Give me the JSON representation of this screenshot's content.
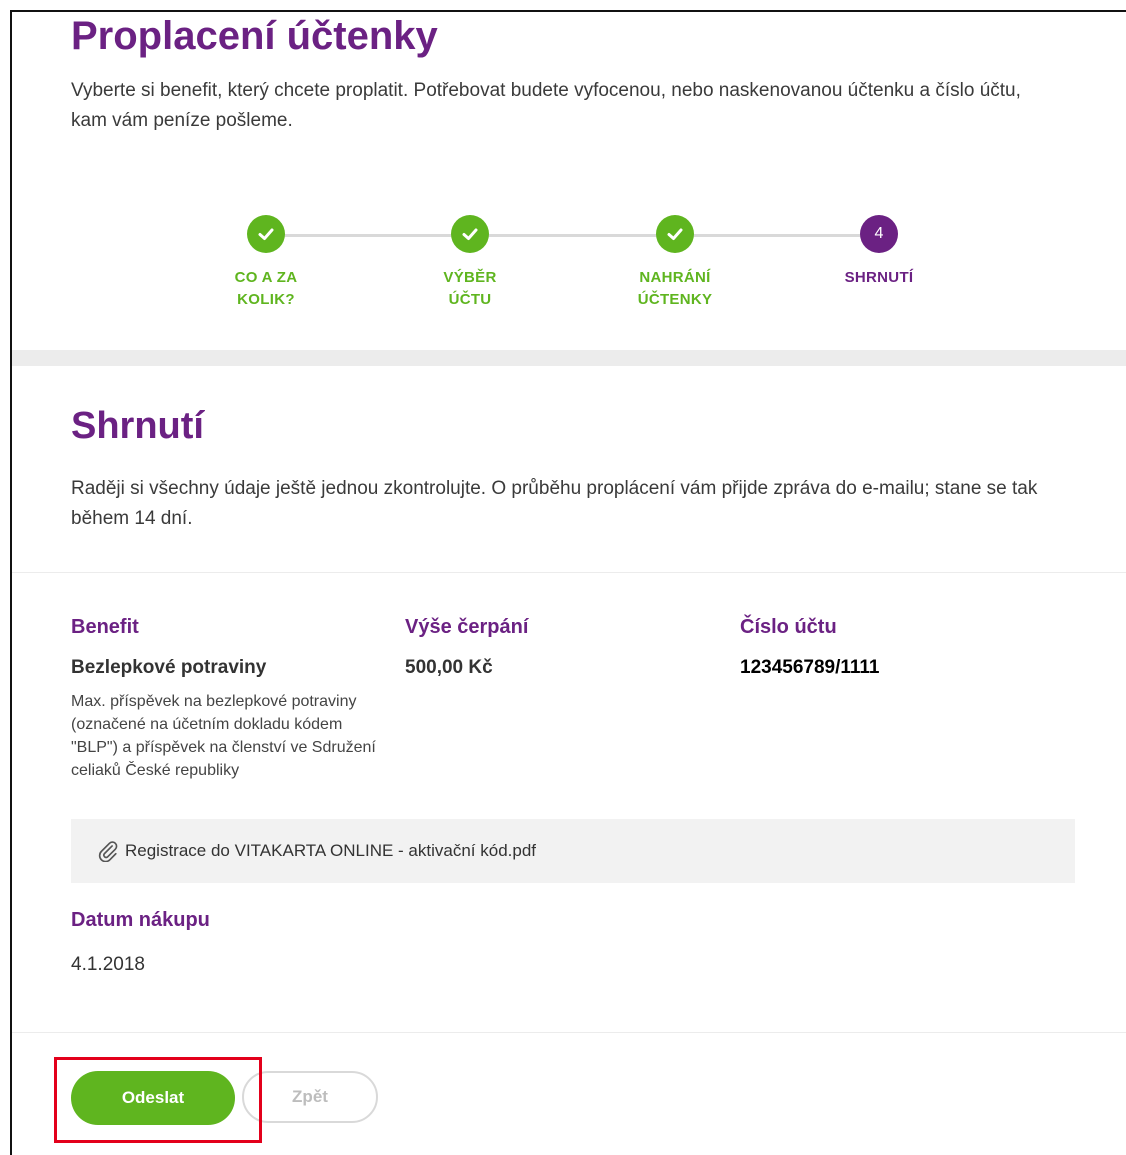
{
  "header": {
    "title": "Proplacení účtenky",
    "intro": "Vyberte si benefit, který chcete proplatit. Potřebovat budete vyfocenou, nebo naskenovanou účtenku a číslo účtu, kam vám peníze pošleme."
  },
  "stepper": {
    "steps": [
      {
        "label_line1": "CO A ZA",
        "label_line2": "KOLIK?",
        "state": "done"
      },
      {
        "label_line1": "VÝBĚR",
        "label_line2": "ÚČTU",
        "state": "done"
      },
      {
        "label_line1": "NAHRÁNÍ",
        "label_line2": "ÚČTENKY",
        "state": "done"
      },
      {
        "label_line1": "SHRNUTÍ",
        "label_line2": "",
        "number": "4",
        "state": "active"
      }
    ]
  },
  "summary": {
    "title": "Shrnutí",
    "intro": "Raději si všechny údaje ještě jednou zkontrolujte. O průběhu proplácení vám přijde zpráva do e-mailu; stane se tak během 14 dní.",
    "benefit_label": "Benefit",
    "benefit_name": "Bezlepkové potraviny",
    "benefit_desc": "Max. příspěvek na bezlepkové potraviny (označené na účetním dokladu kódem \"BLP\") a příspěvek na členství ve Sdružení celiaků České republiky",
    "amount_label": "Výše čerpání",
    "amount_value": "500,00 Kč",
    "account_label": "Číslo účtu",
    "account_value": "123456789/1111",
    "attachment_name": "Registrace do VITAKARTA ONLINE - aktivační kód.pdf",
    "date_label": "Datum nákupu",
    "date_value": "4.1.2018"
  },
  "actions": {
    "send_label": "Odeslat",
    "back_label": "Zpět"
  },
  "colors": {
    "brand_purple": "#6b2183",
    "brand_green": "#5fb51f",
    "highlight_red": "#e3001b"
  },
  "icons": {
    "step_done": "check-icon",
    "attachment": "paperclip-icon"
  }
}
